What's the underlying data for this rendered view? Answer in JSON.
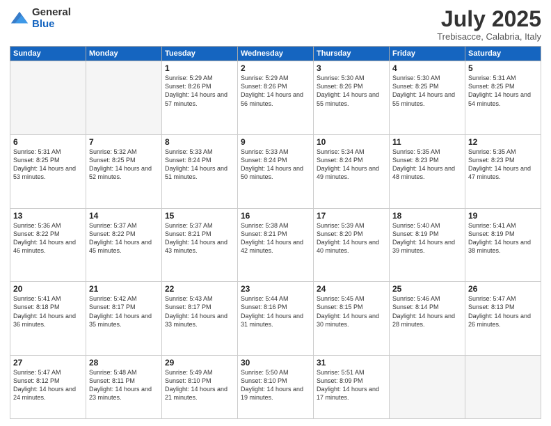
{
  "logo": {
    "general": "General",
    "blue": "Blue"
  },
  "title": "July 2025",
  "location": "Trebisacce, Calabria, Italy",
  "days_of_week": [
    "Sunday",
    "Monday",
    "Tuesday",
    "Wednesday",
    "Thursday",
    "Friday",
    "Saturday"
  ],
  "weeks": [
    [
      {
        "day": "",
        "empty": true
      },
      {
        "day": "",
        "empty": true
      },
      {
        "day": "1",
        "sunrise": "5:29 AM",
        "sunset": "8:26 PM",
        "daylight": "14 hours and 57 minutes."
      },
      {
        "day": "2",
        "sunrise": "5:29 AM",
        "sunset": "8:26 PM",
        "daylight": "14 hours and 56 minutes."
      },
      {
        "day": "3",
        "sunrise": "5:30 AM",
        "sunset": "8:26 PM",
        "daylight": "14 hours and 55 minutes."
      },
      {
        "day": "4",
        "sunrise": "5:30 AM",
        "sunset": "8:25 PM",
        "daylight": "14 hours and 55 minutes."
      },
      {
        "day": "5",
        "sunrise": "5:31 AM",
        "sunset": "8:25 PM",
        "daylight": "14 hours and 54 minutes."
      }
    ],
    [
      {
        "day": "6",
        "sunrise": "5:31 AM",
        "sunset": "8:25 PM",
        "daylight": "14 hours and 53 minutes."
      },
      {
        "day": "7",
        "sunrise": "5:32 AM",
        "sunset": "8:25 PM",
        "daylight": "14 hours and 52 minutes."
      },
      {
        "day": "8",
        "sunrise": "5:33 AM",
        "sunset": "8:24 PM",
        "daylight": "14 hours and 51 minutes."
      },
      {
        "day": "9",
        "sunrise": "5:33 AM",
        "sunset": "8:24 PM",
        "daylight": "14 hours and 50 minutes."
      },
      {
        "day": "10",
        "sunrise": "5:34 AM",
        "sunset": "8:24 PM",
        "daylight": "14 hours and 49 minutes."
      },
      {
        "day": "11",
        "sunrise": "5:35 AM",
        "sunset": "8:23 PM",
        "daylight": "14 hours and 48 minutes."
      },
      {
        "day": "12",
        "sunrise": "5:35 AM",
        "sunset": "8:23 PM",
        "daylight": "14 hours and 47 minutes."
      }
    ],
    [
      {
        "day": "13",
        "sunrise": "5:36 AM",
        "sunset": "8:22 PM",
        "daylight": "14 hours and 46 minutes."
      },
      {
        "day": "14",
        "sunrise": "5:37 AM",
        "sunset": "8:22 PM",
        "daylight": "14 hours and 45 minutes."
      },
      {
        "day": "15",
        "sunrise": "5:37 AM",
        "sunset": "8:21 PM",
        "daylight": "14 hours and 43 minutes."
      },
      {
        "day": "16",
        "sunrise": "5:38 AM",
        "sunset": "8:21 PM",
        "daylight": "14 hours and 42 minutes."
      },
      {
        "day": "17",
        "sunrise": "5:39 AM",
        "sunset": "8:20 PM",
        "daylight": "14 hours and 40 minutes."
      },
      {
        "day": "18",
        "sunrise": "5:40 AM",
        "sunset": "8:19 PM",
        "daylight": "14 hours and 39 minutes."
      },
      {
        "day": "19",
        "sunrise": "5:41 AM",
        "sunset": "8:19 PM",
        "daylight": "14 hours and 38 minutes."
      }
    ],
    [
      {
        "day": "20",
        "sunrise": "5:41 AM",
        "sunset": "8:18 PM",
        "daylight": "14 hours and 36 minutes."
      },
      {
        "day": "21",
        "sunrise": "5:42 AM",
        "sunset": "8:17 PM",
        "daylight": "14 hours and 35 minutes."
      },
      {
        "day": "22",
        "sunrise": "5:43 AM",
        "sunset": "8:17 PM",
        "daylight": "14 hours and 33 minutes."
      },
      {
        "day": "23",
        "sunrise": "5:44 AM",
        "sunset": "8:16 PM",
        "daylight": "14 hours and 31 minutes."
      },
      {
        "day": "24",
        "sunrise": "5:45 AM",
        "sunset": "8:15 PM",
        "daylight": "14 hours and 30 minutes."
      },
      {
        "day": "25",
        "sunrise": "5:46 AM",
        "sunset": "8:14 PM",
        "daylight": "14 hours and 28 minutes."
      },
      {
        "day": "26",
        "sunrise": "5:47 AM",
        "sunset": "8:13 PM",
        "daylight": "14 hours and 26 minutes."
      }
    ],
    [
      {
        "day": "27",
        "sunrise": "5:47 AM",
        "sunset": "8:12 PM",
        "daylight": "14 hours and 24 minutes."
      },
      {
        "day": "28",
        "sunrise": "5:48 AM",
        "sunset": "8:11 PM",
        "daylight": "14 hours and 23 minutes."
      },
      {
        "day": "29",
        "sunrise": "5:49 AM",
        "sunset": "8:10 PM",
        "daylight": "14 hours and 21 minutes."
      },
      {
        "day": "30",
        "sunrise": "5:50 AM",
        "sunset": "8:10 PM",
        "daylight": "14 hours and 19 minutes."
      },
      {
        "day": "31",
        "sunrise": "5:51 AM",
        "sunset": "8:09 PM",
        "daylight": "14 hours and 17 minutes."
      },
      {
        "day": "",
        "empty": true
      },
      {
        "day": "",
        "empty": true
      }
    ]
  ]
}
